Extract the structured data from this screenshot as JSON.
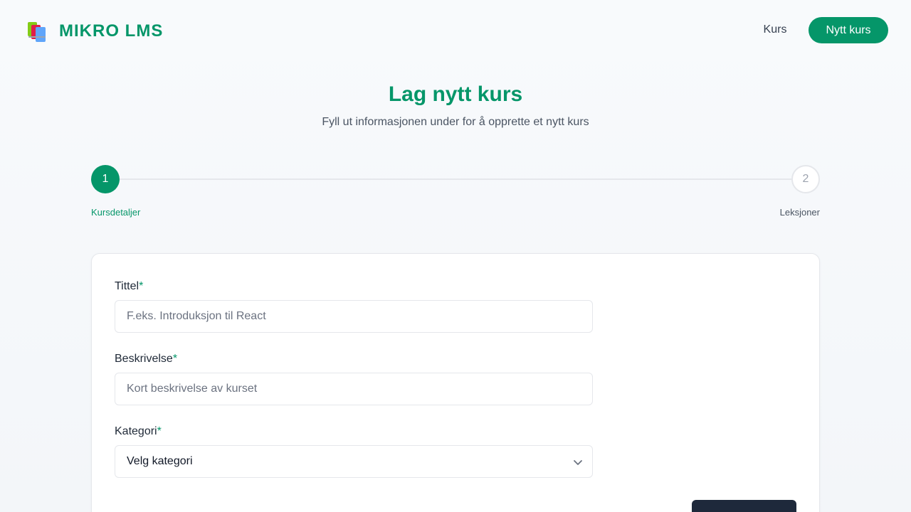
{
  "header": {
    "logo_text": "MIKRO LMS",
    "nav_link": "Kurs",
    "nav_button": "Nytt kurs"
  },
  "page": {
    "title": "Lag nytt kurs",
    "subtitle": "Fyll ut informasjonen under for å opprette et nytt kurs"
  },
  "stepper": {
    "steps": [
      {
        "number": "1",
        "label": "Kursdetaljer",
        "active": true
      },
      {
        "number": "2",
        "label": "Leksjoner",
        "active": false
      }
    ]
  },
  "form": {
    "title": {
      "label": "Tittel",
      "required": "*",
      "placeholder": "F.eks. Introduksjon til React",
      "value": ""
    },
    "description": {
      "label": "Beskrivelse",
      "required": "*",
      "placeholder": "Kort beskrivelse av kurset",
      "value": ""
    },
    "category": {
      "label": "Kategori",
      "required": "*",
      "selected": "Velg kategori"
    }
  },
  "colors": {
    "accent": "#059669",
    "dark_button": "#1e293b"
  },
  "icons": {
    "logo": "books-icon",
    "select": "chevron-down-icon"
  }
}
